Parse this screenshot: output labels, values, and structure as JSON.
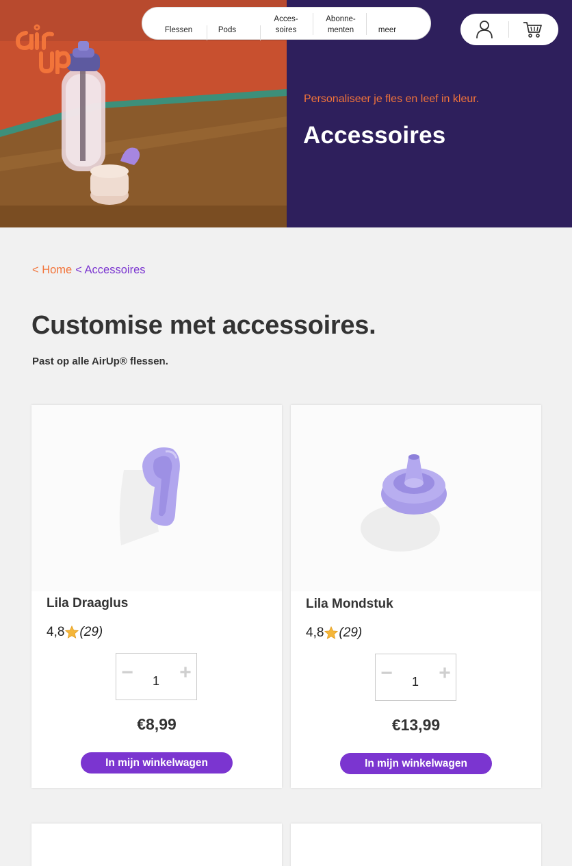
{
  "nav": {
    "items": [
      {
        "label": "Flessen"
      },
      {
        "label": "Pods"
      },
      {
        "label": "Acces-\nsoires"
      },
      {
        "label": "Abonne-\nmenten"
      },
      {
        "label": "meer"
      }
    ]
  },
  "hero": {
    "tagline": "Personaliseer je fles en leef in kleur.",
    "title": "Accessoires"
  },
  "breadcrumb": {
    "home": "< Home",
    "current": "< Accessoires"
  },
  "page": {
    "title": "Customise met accessoires.",
    "subtitle": "Past op alle AirUp® flessen."
  },
  "products": [
    {
      "name": "Lila Draaglus",
      "rating": "4,8",
      "reviews": "(29)",
      "qty": "1",
      "minus": "−",
      "plus": "+",
      "price": "€8,99",
      "button": "In mijn winkelwagen"
    },
    {
      "name": "Lila Mondstuk",
      "rating": "4,8",
      "reviews": "(29)",
      "qty": "1",
      "minus": "−",
      "plus": "+",
      "price": "€13,99",
      "button": "In mijn winkelwagen"
    }
  ],
  "icons": {
    "logo": "air-up-logo",
    "account": "user-icon",
    "cart": "cart-icon",
    "star": "star-icon"
  },
  "colors": {
    "brand_purple": "#7b35d0",
    "hero_panel": "#2e1f5c",
    "accent_orange": "#f2743a",
    "page_bg": "#f1f1f1"
  }
}
